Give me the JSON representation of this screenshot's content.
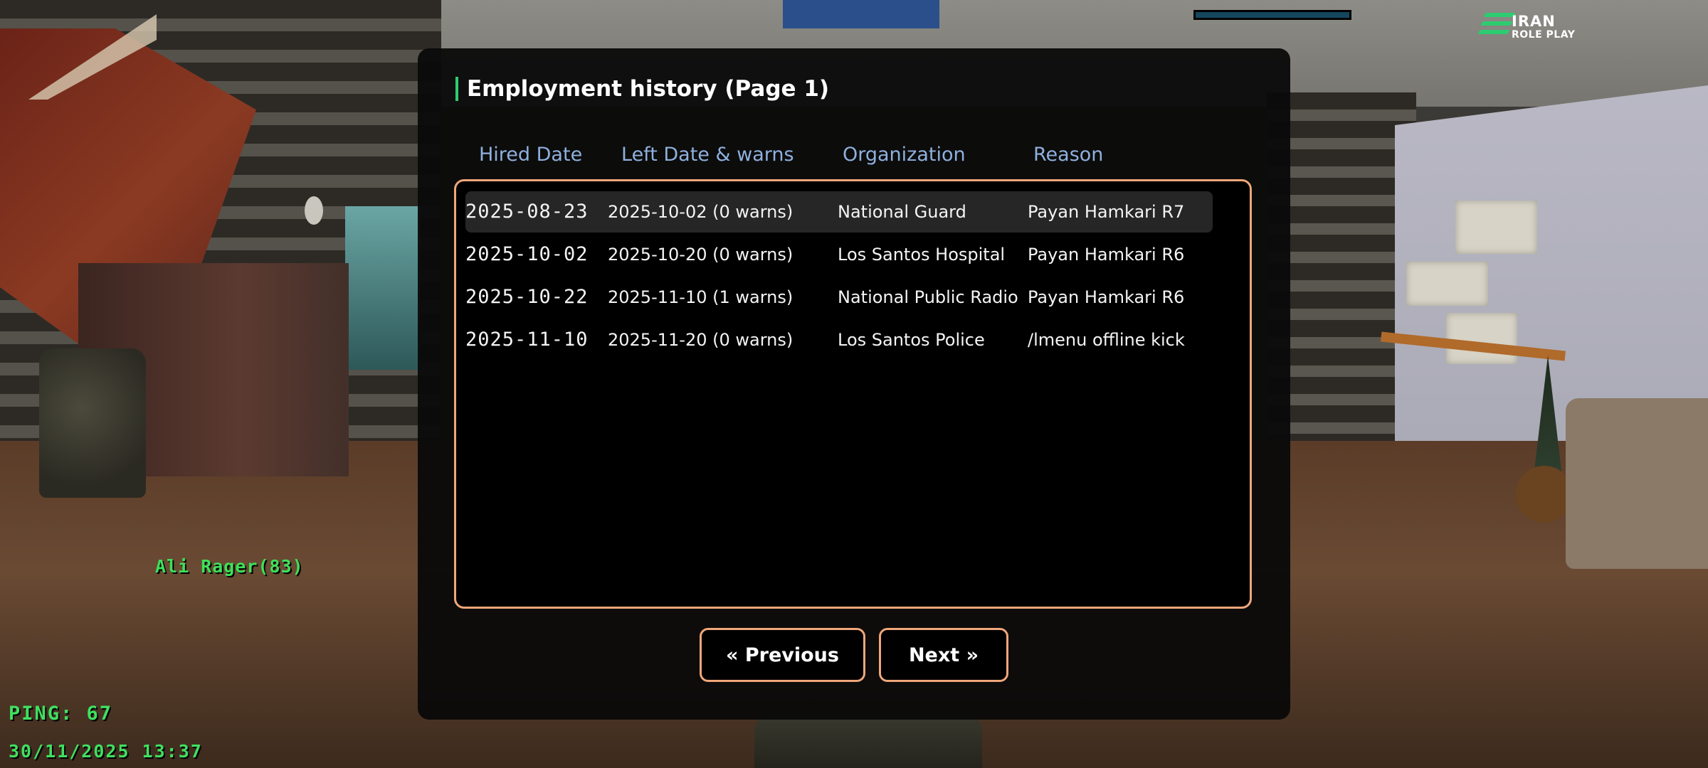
{
  "hud": {
    "logo_line1": "IRAN",
    "logo_line2": "ROLE PLAY",
    "player_name": "Ali Rager(83)",
    "ping": "PING: 67",
    "datetime": "30/11/2025 13:37",
    "status_bar_fill_percent": 100
  },
  "dialog": {
    "title": "Employment history (Page 1)",
    "columns": {
      "hired": "Hired Date",
      "left": "Left Date & warns",
      "org": "Organization",
      "reason": "Reason"
    },
    "rows": [
      {
        "hired": "2025-08-23",
        "left": "2025-10-02 (0 warns)",
        "org": "National Guard",
        "reason": "Payan Hamkari R7"
      },
      {
        "hired": "2025-10-02",
        "left": "2025-10-20 (0 warns)",
        "org": "Los Santos Hospital",
        "reason": "Payan Hamkari R6"
      },
      {
        "hired": "2025-10-22",
        "left": "2025-11-10 (1 warns)",
        "org": "National Public Radio",
        "reason": "Payan Hamkari R6"
      },
      {
        "hired": "2025-11-10",
        "left": "2025-11-20 (0 warns)",
        "org": "Los Santos Police",
        "reason": "/lmenu offline kick"
      }
    ],
    "prev_label": "« Previous",
    "next_label": "Next »"
  },
  "colors": {
    "accent_green": "#2ecc71",
    "border_orange": "#f0a77a",
    "header_blue": "#8fb0de",
    "hud_green": "#40e060"
  }
}
